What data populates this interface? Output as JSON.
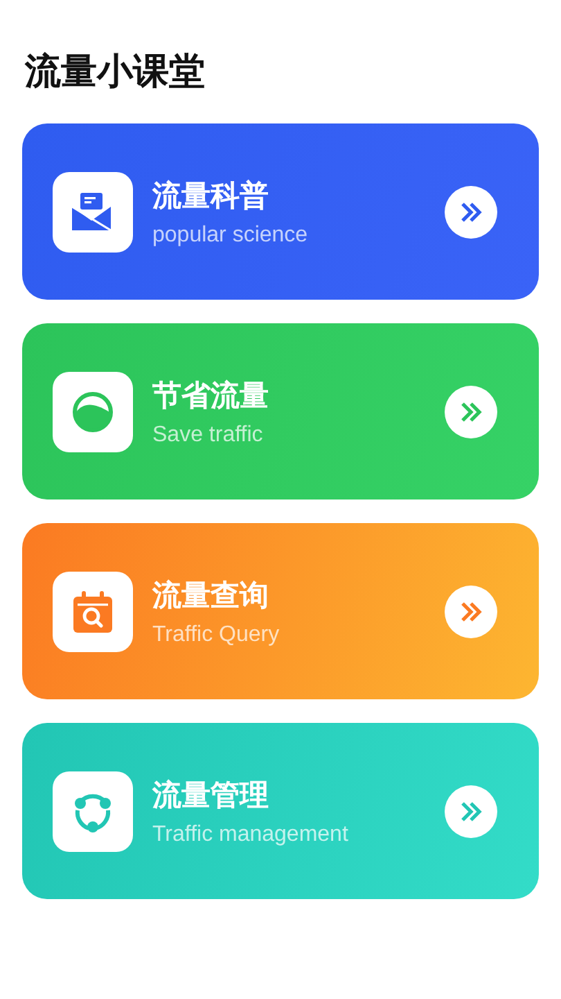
{
  "title": "流量小课堂",
  "cards": [
    {
      "kind": "mail",
      "title": "流量科普",
      "subtitle": "popular science",
      "color": "#2f5cf0"
    },
    {
      "kind": "save",
      "title": "节省流量",
      "subtitle": "Save traffic",
      "color": "#2cc45a"
    },
    {
      "kind": "query",
      "title": "流量查询",
      "subtitle": "Traffic Query",
      "color": "#fb7a22"
    },
    {
      "kind": "manage",
      "title": "流量管理",
      "subtitle": "Traffic management",
      "color": "#22c6b4"
    }
  ]
}
